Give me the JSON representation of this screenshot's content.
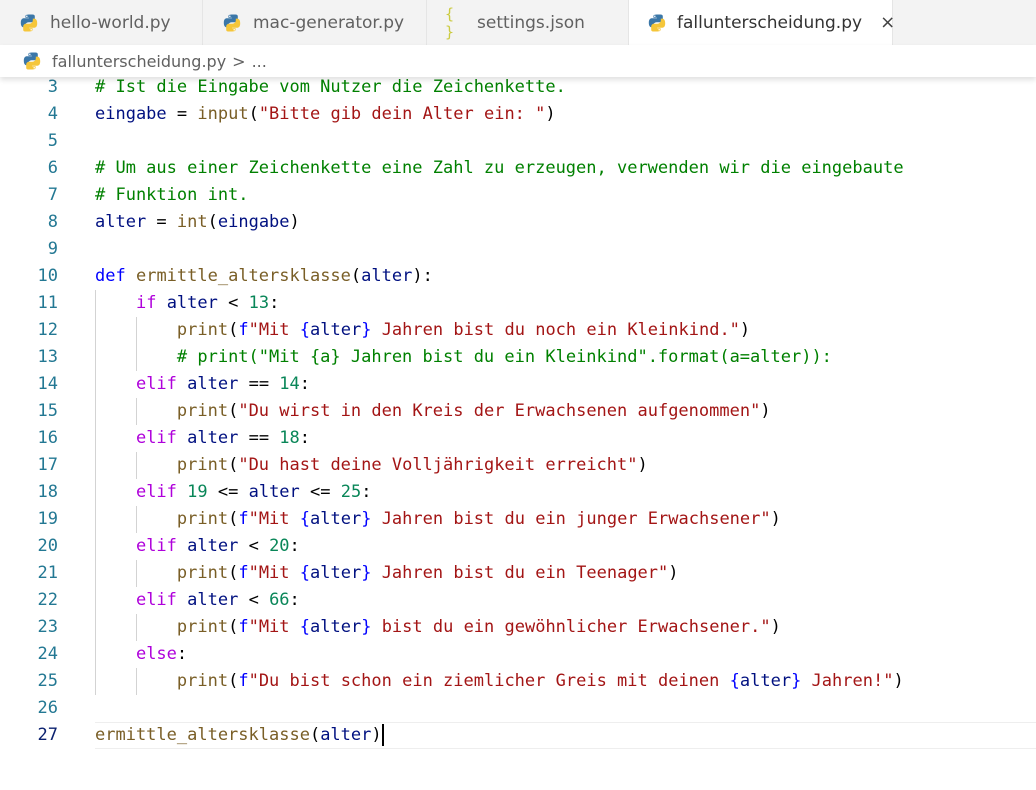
{
  "tabs": [
    {
      "label": "hello-world.py",
      "icon": "python-icon",
      "active": false
    },
    {
      "label": "mac-generator.py",
      "icon": "python-icon",
      "active": false
    },
    {
      "label": "settings.json",
      "icon": "json-icon",
      "active": false
    },
    {
      "label": "fallunterscheidung.py",
      "icon": "python-icon",
      "active": true
    }
  ],
  "json_icon_glyph": "{ }",
  "close_glyph": "×",
  "breadcrumb": {
    "file": "fallunterscheidung.py",
    "separator": ">",
    "more": "..."
  },
  "line_numbers": [
    "3",
    "4",
    "5",
    "6",
    "7",
    "8",
    "9",
    "10",
    "11",
    "12",
    "13",
    "14",
    "15",
    "16",
    "17",
    "18",
    "19",
    "20",
    "21",
    "22",
    "23",
    "24",
    "25",
    "26",
    "27"
  ],
  "current_line": "27",
  "lines": [
    [
      [
        "c",
        "# Ist die Eingabe vom Nutzer die Zeichenkette."
      ]
    ],
    [
      [
        "v",
        "eingabe"
      ],
      [
        "p",
        " = "
      ],
      [
        "f",
        "input"
      ],
      [
        "p",
        "("
      ],
      [
        "s",
        "\"Bitte gib dein Alter ein: \""
      ],
      [
        "p",
        ")"
      ]
    ],
    [],
    [
      [
        "c",
        "# Um aus einer Zeichenkette eine Zahl zu erzeugen, verwenden wir die eingebaute"
      ]
    ],
    [
      [
        "c",
        "# Funktion int."
      ]
    ],
    [
      [
        "v",
        "alter"
      ],
      [
        "p",
        " = "
      ],
      [
        "f",
        "int"
      ],
      [
        "p",
        "("
      ],
      [
        "v",
        "eingabe"
      ],
      [
        "p",
        ")"
      ]
    ],
    [],
    [
      [
        "d",
        "def"
      ],
      [
        "p",
        " "
      ],
      [
        "f",
        "ermittle_altersklasse"
      ],
      [
        "p",
        "("
      ],
      [
        "v",
        "alter"
      ],
      [
        "p",
        "):"
      ]
    ],
    [
      [
        "p",
        "    "
      ],
      [
        "k",
        "if"
      ],
      [
        "p",
        " "
      ],
      [
        "v",
        "alter"
      ],
      [
        "p",
        " < "
      ],
      [
        "n",
        "13"
      ],
      [
        "p",
        ":"
      ]
    ],
    [
      [
        "p",
        "        "
      ],
      [
        "f",
        "print"
      ],
      [
        "p",
        "("
      ],
      [
        "d",
        "f"
      ],
      [
        "s",
        "\"Mit "
      ],
      [
        "d",
        "{"
      ],
      [
        "v",
        "alter"
      ],
      [
        "d",
        "}"
      ],
      [
        "s",
        " Jahren bist du noch ein Kleinkind.\""
      ],
      [
        "p",
        ")"
      ]
    ],
    [
      [
        "p",
        "        "
      ],
      [
        "c",
        "# print(\"Mit {a} Jahren bist du ein Kleinkind\".format(a=alter)):"
      ]
    ],
    [
      [
        "p",
        "    "
      ],
      [
        "k",
        "elif"
      ],
      [
        "p",
        " "
      ],
      [
        "v",
        "alter"
      ],
      [
        "p",
        " == "
      ],
      [
        "n",
        "14"
      ],
      [
        "p",
        ":"
      ]
    ],
    [
      [
        "p",
        "        "
      ],
      [
        "f",
        "print"
      ],
      [
        "p",
        "("
      ],
      [
        "s",
        "\"Du wirst in den Kreis der Erwachsenen aufgenommen\""
      ],
      [
        "p",
        ")"
      ]
    ],
    [
      [
        "p",
        "    "
      ],
      [
        "k",
        "elif"
      ],
      [
        "p",
        " "
      ],
      [
        "v",
        "alter"
      ],
      [
        "p",
        " == "
      ],
      [
        "n",
        "18"
      ],
      [
        "p",
        ":"
      ]
    ],
    [
      [
        "p",
        "        "
      ],
      [
        "f",
        "print"
      ],
      [
        "p",
        "("
      ],
      [
        "s",
        "\"Du hast deine Volljährigkeit erreicht\""
      ],
      [
        "p",
        ")"
      ]
    ],
    [
      [
        "p",
        "    "
      ],
      [
        "k",
        "elif"
      ],
      [
        "p",
        " "
      ],
      [
        "n",
        "19"
      ],
      [
        "p",
        " <= "
      ],
      [
        "v",
        "alter"
      ],
      [
        "p",
        " <= "
      ],
      [
        "n",
        "25"
      ],
      [
        "p",
        ":"
      ]
    ],
    [
      [
        "p",
        "        "
      ],
      [
        "f",
        "print"
      ],
      [
        "p",
        "("
      ],
      [
        "d",
        "f"
      ],
      [
        "s",
        "\"Mit "
      ],
      [
        "d",
        "{"
      ],
      [
        "v",
        "alter"
      ],
      [
        "d",
        "}"
      ],
      [
        "s",
        " Jahren bist du ein junger Erwachsener\""
      ],
      [
        "p",
        ")"
      ]
    ],
    [
      [
        "p",
        "    "
      ],
      [
        "k",
        "elif"
      ],
      [
        "p",
        " "
      ],
      [
        "v",
        "alter"
      ],
      [
        "p",
        " < "
      ],
      [
        "n",
        "20"
      ],
      [
        "p",
        ":"
      ]
    ],
    [
      [
        "p",
        "        "
      ],
      [
        "f",
        "print"
      ],
      [
        "p",
        "("
      ],
      [
        "d",
        "f"
      ],
      [
        "s",
        "\"Mit "
      ],
      [
        "d",
        "{"
      ],
      [
        "v",
        "alter"
      ],
      [
        "d",
        "}"
      ],
      [
        "s",
        " Jahren bist du ein Teenager\""
      ],
      [
        "p",
        ")"
      ]
    ],
    [
      [
        "p",
        "    "
      ],
      [
        "k",
        "elif"
      ],
      [
        "p",
        " "
      ],
      [
        "v",
        "alter"
      ],
      [
        "p",
        " < "
      ],
      [
        "n",
        "66"
      ],
      [
        "p",
        ":"
      ]
    ],
    [
      [
        "p",
        "        "
      ],
      [
        "f",
        "print"
      ],
      [
        "p",
        "("
      ],
      [
        "d",
        "f"
      ],
      [
        "s",
        "\"Mit "
      ],
      [
        "d",
        "{"
      ],
      [
        "v",
        "alter"
      ],
      [
        "d",
        "}"
      ],
      [
        "s",
        " bist du ein gewöhnlicher Erwachsener.\""
      ],
      [
        "p",
        ")"
      ]
    ],
    [
      [
        "p",
        "    "
      ],
      [
        "k",
        "else"
      ],
      [
        "p",
        ":"
      ]
    ],
    [
      [
        "p",
        "        "
      ],
      [
        "f",
        "print"
      ],
      [
        "p",
        "("
      ],
      [
        "d",
        "f"
      ],
      [
        "s",
        "\"Du bist schon ein ziemlicher Greis mit deinen "
      ],
      [
        "d",
        "{"
      ],
      [
        "v",
        "alter"
      ],
      [
        "d",
        "}"
      ],
      [
        "s",
        " Jahren!\""
      ],
      [
        "p",
        ")"
      ]
    ],
    [],
    [
      [
        "f",
        "ermittle_altersklasse"
      ],
      [
        "p",
        "("
      ],
      [
        "v",
        "alter"
      ],
      [
        "p",
        ")"
      ]
    ]
  ],
  "colors": {
    "keyword_control": "#af00db",
    "keyword_def": "#0000ff",
    "function": "#795e26",
    "variable": "#001080",
    "string": "#a31515",
    "number": "#098658",
    "comment": "#008000",
    "line_number": "#237893"
  }
}
